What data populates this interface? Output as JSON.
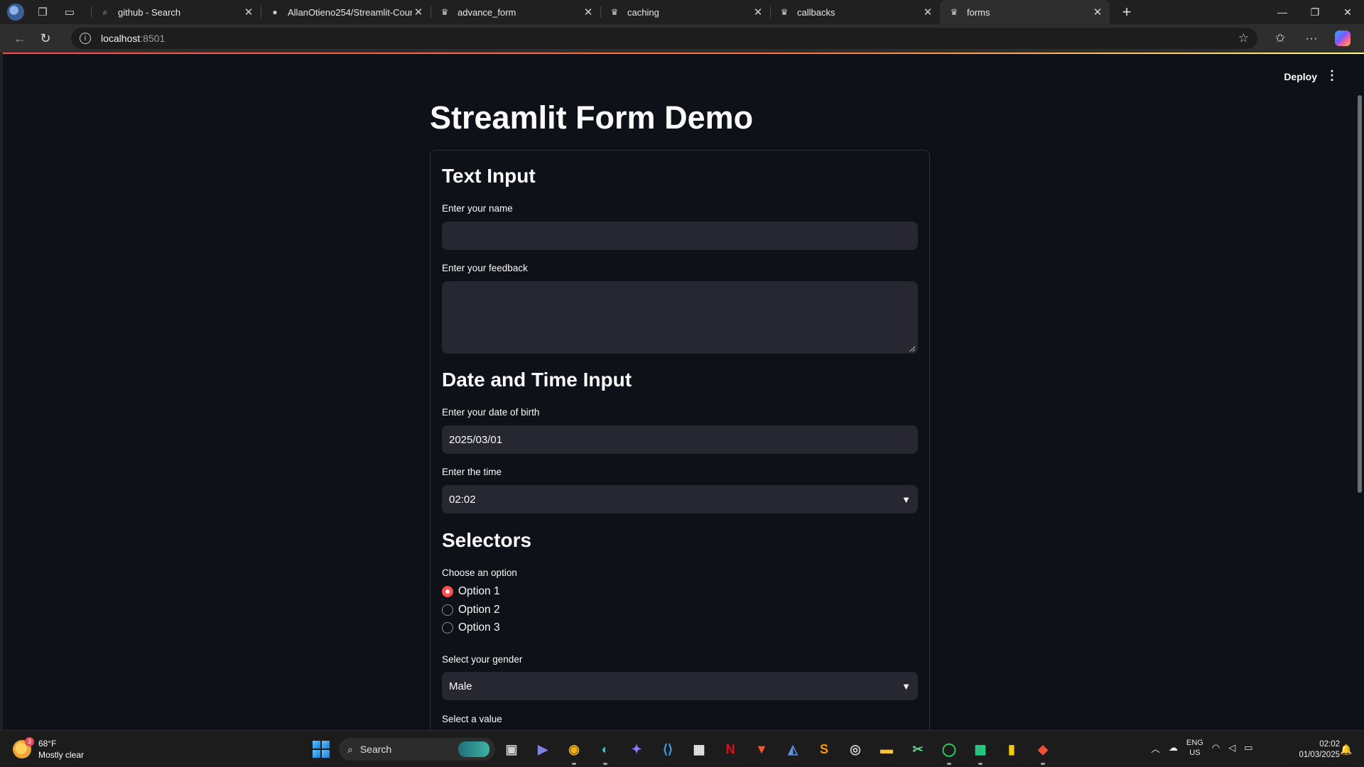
{
  "browser": {
    "tabs": [
      {
        "label": "github - Search",
        "icon": "search-icon"
      },
      {
        "label": "AllanOtieno254/Streamlit-Course",
        "icon": "github-icon"
      },
      {
        "label": "advance_form",
        "icon": "streamlit-icon"
      },
      {
        "label": "caching",
        "icon": "streamlit-icon"
      },
      {
        "label": "callbacks",
        "icon": "streamlit-icon"
      },
      {
        "label": "forms",
        "icon": "streamlit-icon",
        "active": true
      }
    ],
    "url_host": "localhost",
    "url_port": ":8501"
  },
  "app": {
    "deploy_label": "Deploy",
    "title": "Streamlit Form Demo",
    "accent": "#ff4b4b",
    "background": "#0e1117",
    "sections": {
      "text_input": "Text Input",
      "datetime": "Date and Time Input",
      "selectors": "Selectors"
    },
    "fields": {
      "name": {
        "label": "Enter your name",
        "value": ""
      },
      "feedback": {
        "label": "Enter your feedback",
        "value": ""
      },
      "dob": {
        "label": "Enter your date of birth",
        "value": "2025/03/01"
      },
      "time": {
        "label": "Enter the time",
        "value": "02:02"
      },
      "option": {
        "label": "Choose an option",
        "options": [
          "Option 1",
          "Option 2",
          "Option 3"
        ],
        "selected": "Option 1"
      },
      "gender": {
        "label": "Select your gender",
        "value": "Male"
      },
      "value": {
        "label": "Select a value"
      }
    }
  },
  "taskbar": {
    "weather_temp": "68°F",
    "weather_desc": "Mostly clear",
    "weather_badge": "3",
    "search_label": "Search",
    "lang_line1": "ENG",
    "lang_line2": "US",
    "time": "02:02",
    "date": "01/03/2025"
  }
}
